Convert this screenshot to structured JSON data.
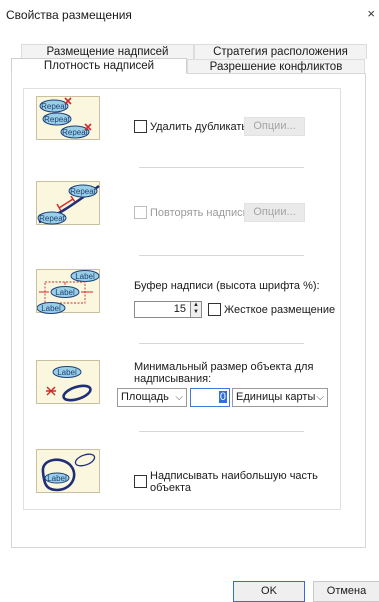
{
  "window": {
    "title": "Свойства размещения",
    "close_glyph": "×"
  },
  "tabs": {
    "row_back": [
      "Размещение надписей",
      "Стратегия расположения"
    ],
    "row_front": [
      "Плотность надписей",
      "Разрешение конфликтов"
    ],
    "active": "Плотность надписей"
  },
  "illustrations": {
    "repeat_label": "Repeat",
    "label": "Label"
  },
  "duplicates": {
    "checkbox_label": "Удалить дубликаты",
    "checked": false,
    "options_button": "Опции..."
  },
  "repeat": {
    "checkbox_label": "Повторять надпись",
    "enabled": false,
    "options_button": "Опции..."
  },
  "buffer": {
    "label": "Буфер надписи (высота шрифта %):",
    "value": "15",
    "hard_placement_label": "Жесткое размещение",
    "hard_placement_checked": false
  },
  "min_feature": {
    "label_line1": "Минимальный размер объекта для",
    "label_line2": "надписывания:",
    "measure_select": "Площадь",
    "value": "0",
    "units_select": "Единицы карты"
  },
  "largest_part": {
    "label_line1": "Надписывать наибольшую часть",
    "label_line2": "объекта",
    "checked": false
  },
  "footer": {
    "ok_label": "OK",
    "cancel_label": "Отмена"
  },
  "colors": {
    "bubble_fill": "#9ad0e6",
    "bubble_stroke": "#1f3f7a",
    "cross": "#d22b2b",
    "feature_line": "#1f2e78"
  }
}
